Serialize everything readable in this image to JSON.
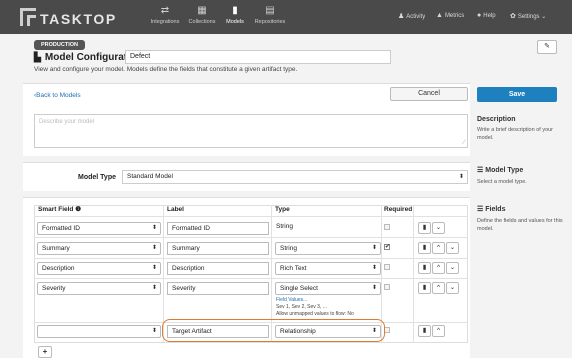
{
  "nav": {
    "logo_text": "TASKTOP",
    "items": [
      {
        "label": "Integrations",
        "icon": "integrations-icon",
        "glyph": "⇄"
      },
      {
        "label": "Collections",
        "icon": "collections-icon",
        "glyph": "▦"
      },
      {
        "label": "Models",
        "icon": "models-icon",
        "glyph": "▮"
      },
      {
        "label": "Repositories",
        "icon": "repositories-icon",
        "glyph": "▤"
      }
    ],
    "right": [
      {
        "label": "Activity",
        "glyph": "♟"
      },
      {
        "label": "Metrics",
        "glyph": "▲"
      },
      {
        "label": "Help",
        "glyph": "●"
      },
      {
        "label": "Settings ⌄",
        "glyph": "✿"
      }
    ]
  },
  "header": {
    "badge": "PRODUCTION",
    "title": "Model Configuration",
    "name_value": "Defect",
    "subtitle": "View and configure your model. Models define the fields that constitute a given artifact type."
  },
  "actions": {
    "back": "‹Back to Models",
    "cancel": "Cancel",
    "save": "Save"
  },
  "description": {
    "placeholder": "Describe your model",
    "side_title": "Description",
    "side_text": "Write a brief description of your model."
  },
  "model_type": {
    "label": "Model Type",
    "value": "Standard Model",
    "side_title": "Model Type",
    "side_text": "Select a model type."
  },
  "fields": {
    "side_title": "Fields",
    "side_text": "Define the fields and values for this model.",
    "headers": [
      "Smart Field ❶",
      "Label",
      "Type",
      "Required"
    ],
    "rows": [
      {
        "smart": "Formatted ID",
        "label": "Formatted ID",
        "type": "String"
      },
      {
        "smart": "Summary",
        "label": "Summary",
        "type": "String"
      },
      {
        "smart": "Description",
        "label": "Description",
        "type": "Rich Text"
      },
      {
        "smart": "Severity",
        "label": "Severity",
        "type": "Single Select",
        "field_values_link": "Field Values...",
        "values": "Sev 1, Sev 2, Sev 3, ...",
        "allow": "Allow unmapped values to flow: No"
      },
      {
        "smart": "",
        "label": "Target Artifact",
        "type": "Relationship"
      }
    ],
    "required": [
      false,
      true,
      false,
      false,
      false
    ]
  },
  "colors": {
    "accent": "#1f80c0",
    "highlight": "#e07a2e",
    "nav_bg": "#4a4a4a"
  }
}
